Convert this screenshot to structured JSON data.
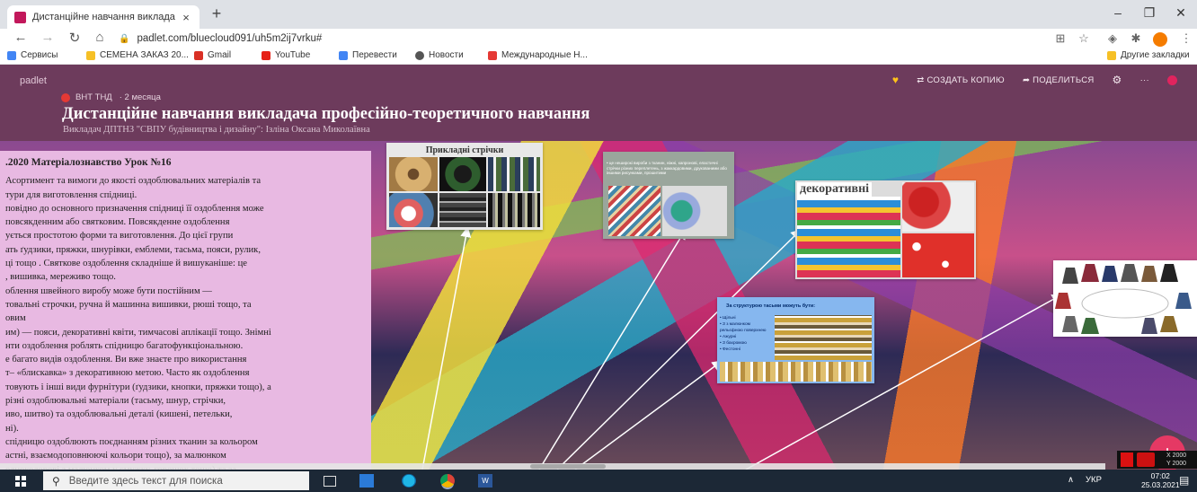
{
  "browser": {
    "tab_title": "Дистанційне навчання виклада",
    "tab_close": "×",
    "new_tab": "+",
    "win_min": "–",
    "win_max": "❐",
    "win_close": "✕",
    "url": "padlet.com/bluecloud091/uh5m2ij7vrku#",
    "bookmarks": [
      "Сервисы",
      "СЕМЕНА ЗАКАЗ 20...",
      "Gmail",
      "YouTube",
      "Перевести",
      "Новости",
      "Международные Н..."
    ],
    "other_bookmarks": "Другие закладки"
  },
  "padlet": {
    "brand": "padlet",
    "actions": {
      "copy": "⇄ СОЗДАТЬ КОПИЮ",
      "share": "➦ ПОДЕЛИТЬСЯ",
      "more": "···"
    },
    "author": "ВНТ ТНД",
    "time_ago": "· 2 месяца",
    "title": "Дистанційне навчання викладача професійно-теоретичного навчання",
    "subtitle": "Викладач ДПТНЗ \"СВПУ будівництва і дизайну\": Ізліна Оксана Миколаївна",
    "text_card": {
      "heading": ".2020  Матеріалознавство   Урок №16",
      "lines": [
        "Асортимент та вимоги до якості оздоблювальних матеріалів та",
        "тури для виготовлення спідниці.",
        "повідно до основного призначення спідниці її оздоблення може",
        "повсякденним або святковим. Повсякденне оздоблення",
        "ується простотою форми та виготовлення. До цієї групи",
        "ать ґудзики, пряжки, шнурівки, емблеми, тасьма, пояси, рулик,",
        "ці тощо . Святкове оздоблення складніше й вишуканіше: це",
        ", вишивка, мереживо тощо.",
        "облення швейного виробу може бути постійним —",
        "товальні строчки, ручна й машинна вишивки, рюші тощо, та",
        "овим",
        "им) — пояси, декоративні квіти, тимчасові аплікації тощо. Знімні",
        "нти оздоблення роблять спідницю багатофункціональною.",
        "е багато видів оздоблення. Ви вже знаєте про використання",
        "т– «блискавка» з декоративною метою. Часто як оздоблення",
        "товують і інші види фурнітури (ґудзики, кнопки, пряжки тощо), а",
        "різні оздоблювальні матеріали (тасьму, шнур, стрічки,",
        "иво, шитво) та оздоблювальні деталі (кишені, петельки,",
        "ні).",
        "спідницю оздоблюють поєднанням різних тканин за кольором",
        "астні, взаємодоповнюючі кольори тощо), за малюнком",
        "одноколорові з малюнком у смужку, горошок тощо) та за"
      ]
    },
    "card1_caption": "Прикладні стрічки",
    "card2_text": "• це неширокі вироби з тканин, ніжні, капронові, еластичні стрічки різних переплетень, з жаккардовими, друкованими або іншими рисунками, прошитими",
    "card3_caption": "декоративні",
    "card4_caption": "За структурою тасьми можуть бути:",
    "card4_items": [
      "Щільні",
      "З з малюнком рельєфною поверхнею",
      "Ажурні",
      "З бахромою",
      "Фестонні"
    ],
    "fab": "+",
    "overlay_text": "X 2000\nY 2000"
  },
  "taskbar": {
    "search_placeholder": "Введите здесь текст для поиска",
    "lang": "УКР",
    "time": "07:02",
    "date": "25.03.2021",
    "tray_arrow": "∧"
  },
  "colors": {
    "header": "#6d3b5c",
    "text_card": "#e8b9e2",
    "fab": "#e53964",
    "taskbar": "#1c2836"
  }
}
